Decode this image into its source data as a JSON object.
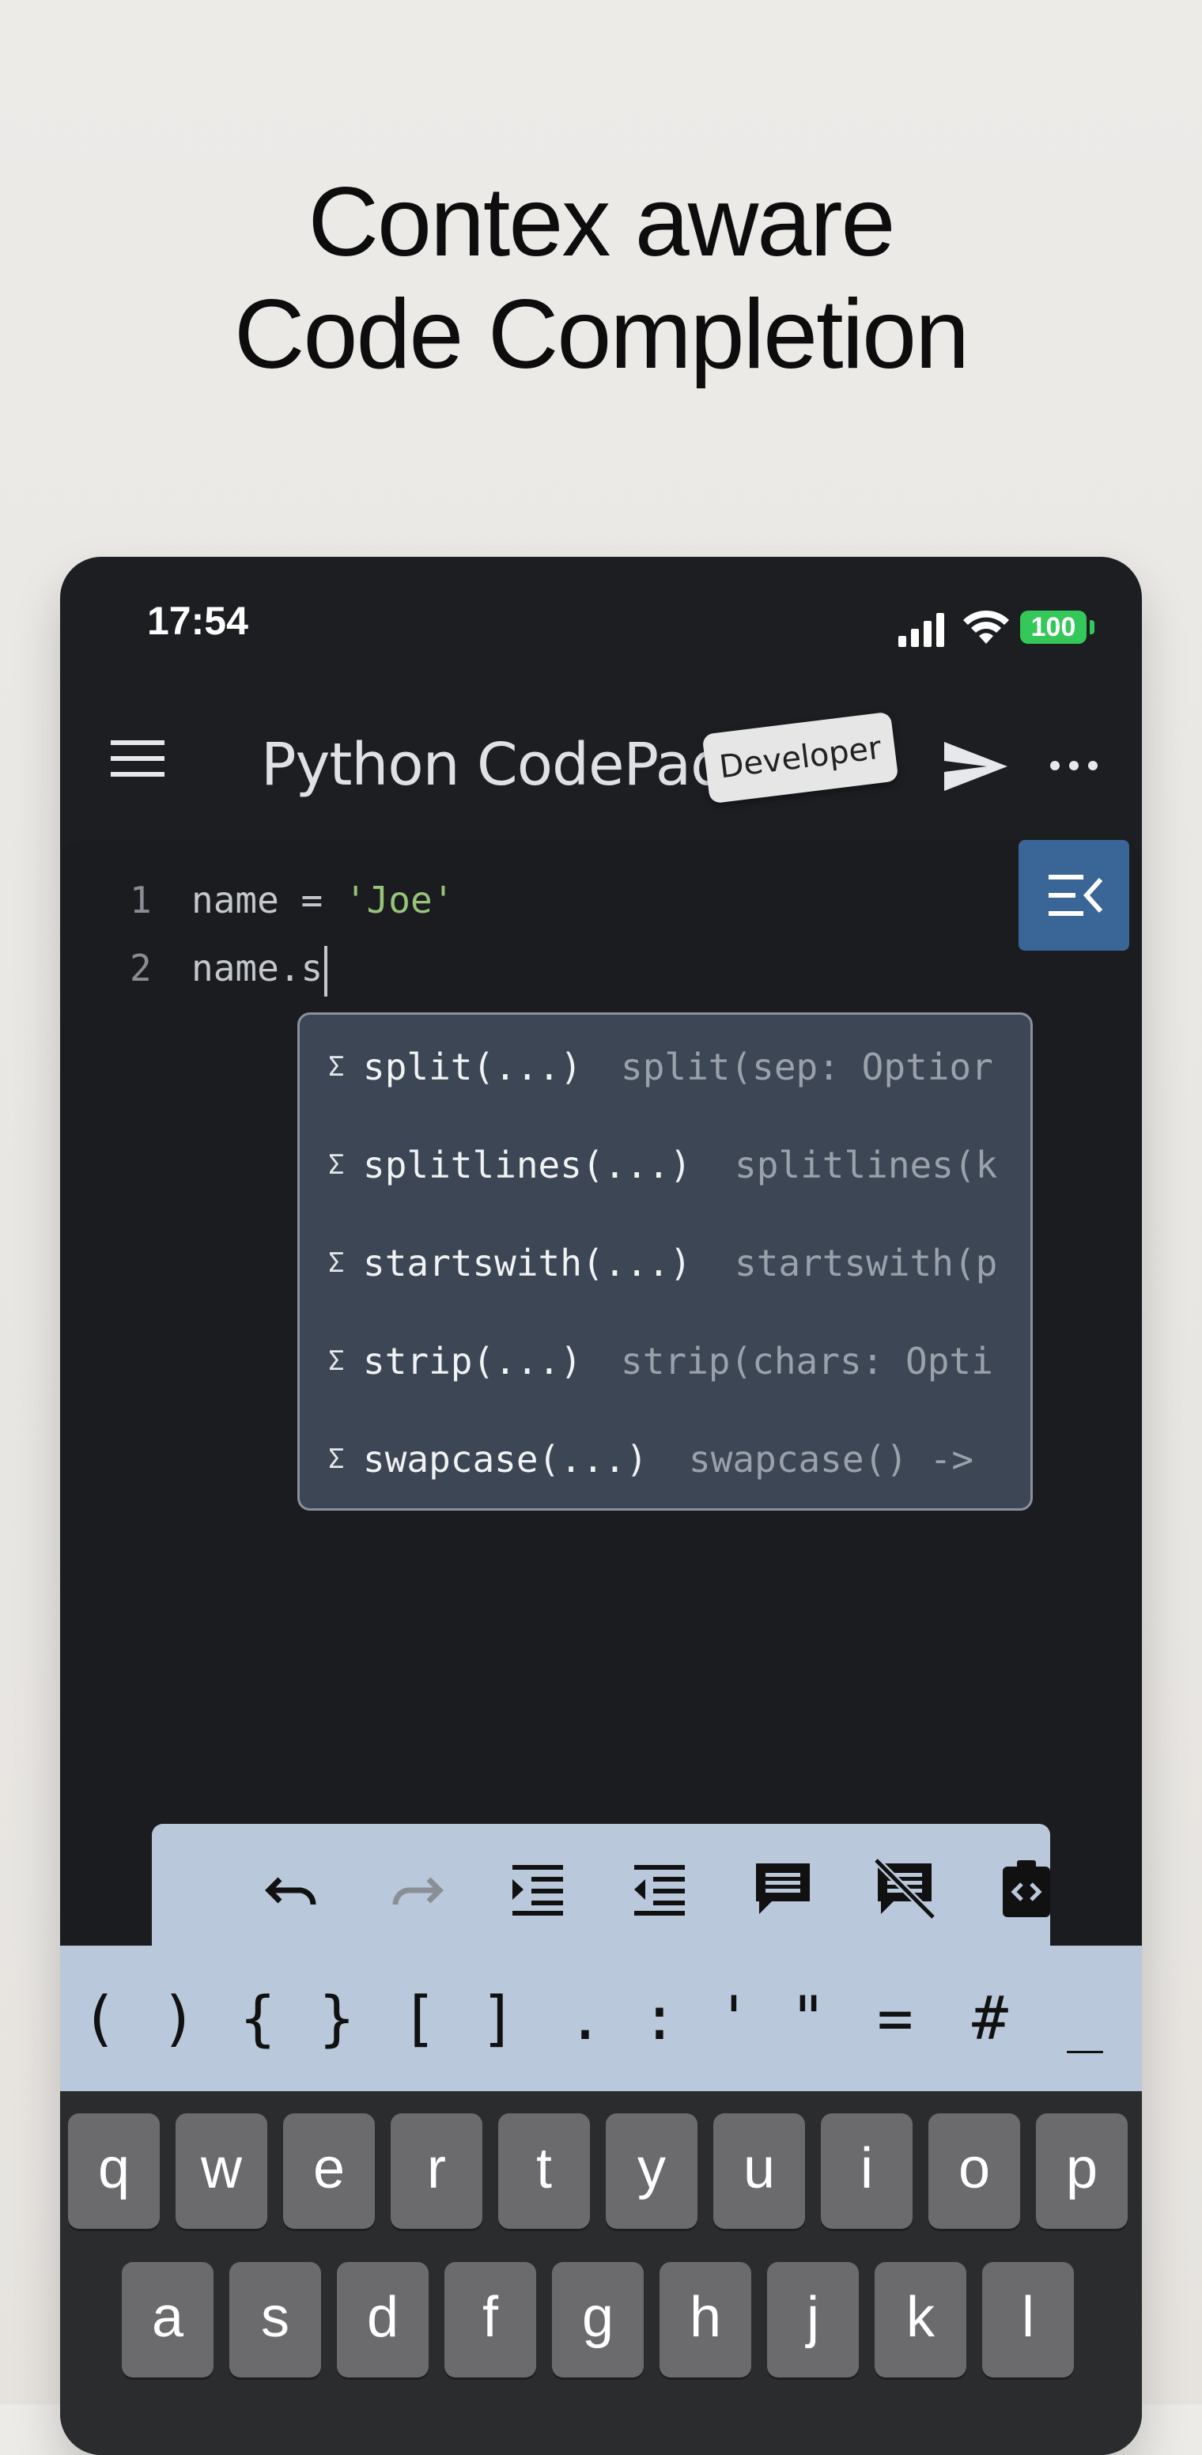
{
  "headline": {
    "line1": "Contex aware",
    "line2": "Code Completion"
  },
  "status": {
    "time": "17:54",
    "battery": "100"
  },
  "app": {
    "title": "Python CodePad",
    "badge": "Developer"
  },
  "editor": {
    "lines": [
      {
        "num": "1",
        "code_prefix": "name = ",
        "code_string": "'Joe'"
      },
      {
        "num": "2",
        "code_prefix": "name.s",
        "code_string": ""
      }
    ]
  },
  "suggestions": [
    {
      "name": "split(...)",
      "detail": "split(sep: Optior"
    },
    {
      "name": "splitlines(...)",
      "detail": "splitlines(k"
    },
    {
      "name": "startswith(...)",
      "detail": "startswith(p"
    },
    {
      "name": "strip(...)",
      "detail": "strip(chars: Opti"
    },
    {
      "name": "swapcase(...)",
      "detail": "swapcase() ->"
    }
  ],
  "suggestion_kind_glyph": "Σ",
  "actions": [
    "undo-icon",
    "redo-icon",
    "indent-icon",
    "outdent-icon",
    "comment-icon",
    "uncomment-icon",
    "snippet-icon"
  ],
  "symbols": [
    "(",
    ")",
    "{",
    "}",
    "[",
    "]",
    ".",
    ":",
    "'",
    "\"",
    "=",
    "#",
    "_"
  ],
  "keyboard": {
    "row1": [
      "q",
      "w",
      "e",
      "r",
      "t",
      "y",
      "u",
      "i",
      "o",
      "p"
    ],
    "row2": [
      "a",
      "s",
      "d",
      "f",
      "g",
      "h",
      "j",
      "k",
      "l"
    ]
  },
  "colors": {
    "accent": "#3a6597",
    "symbar": "#bac8dc",
    "string": "#98c379",
    "battery": "#34c759"
  }
}
